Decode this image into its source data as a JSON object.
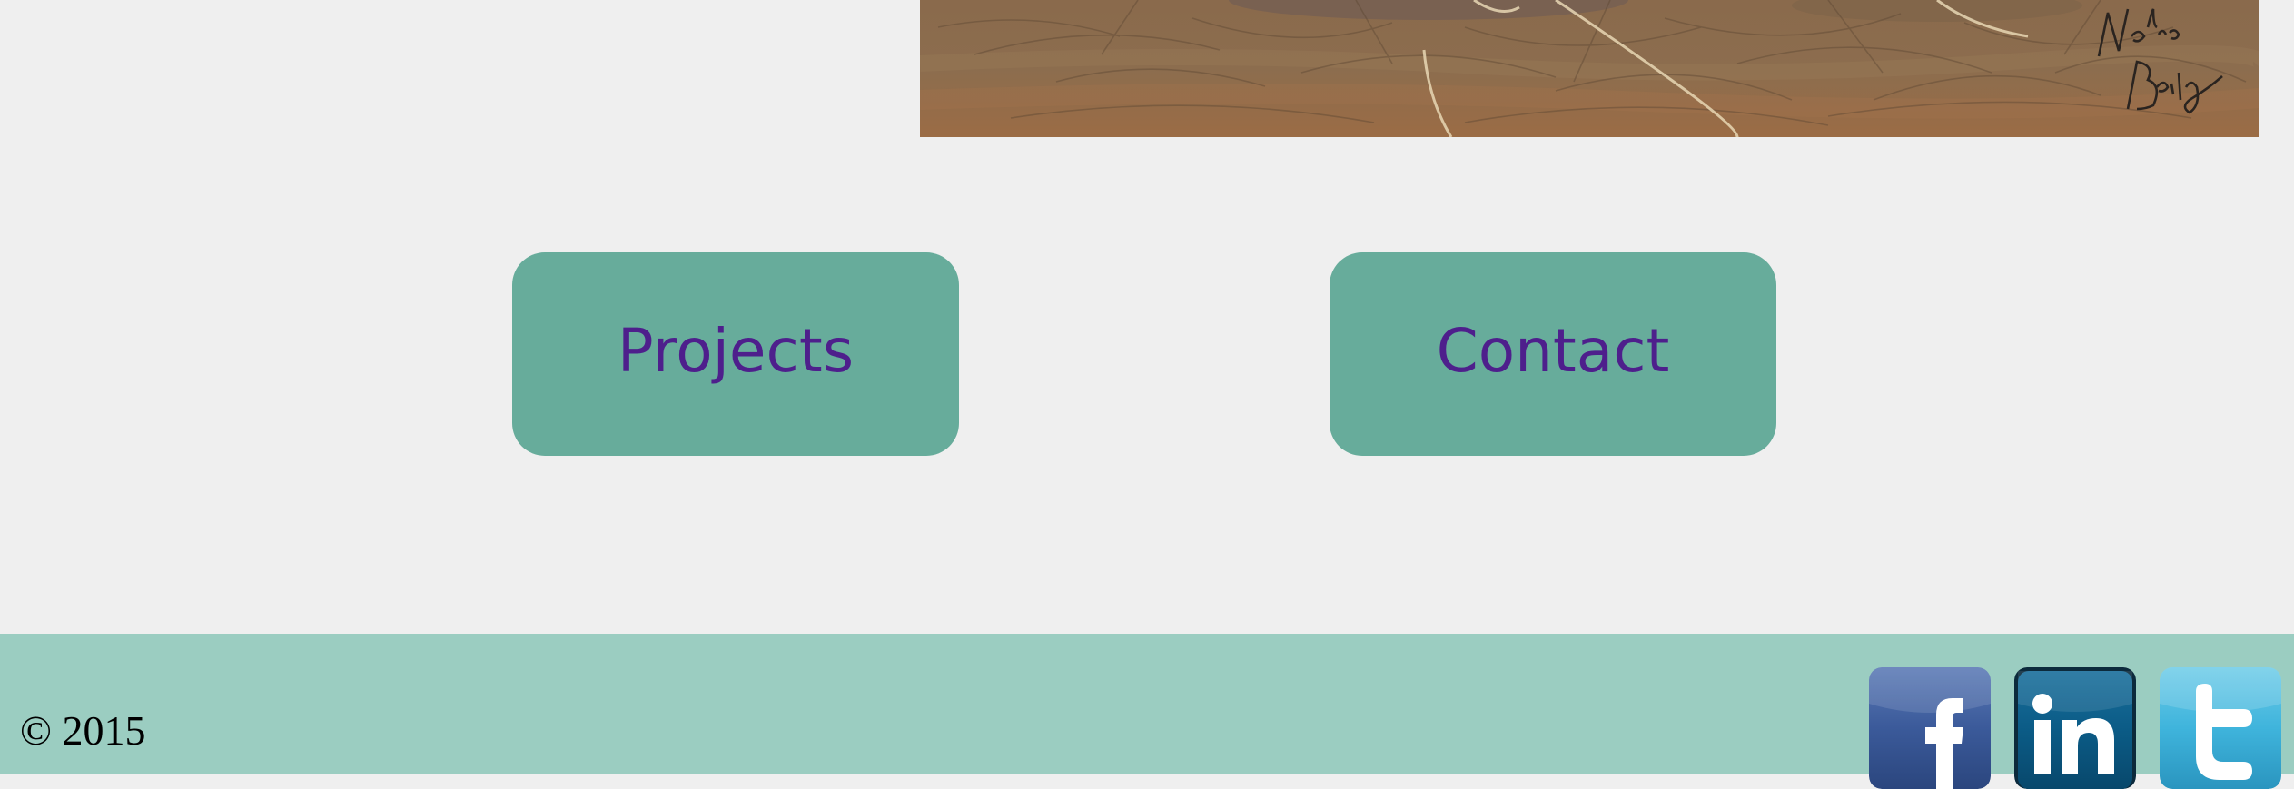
{
  "artwork": {
    "description_alt": "Painted artwork banner",
    "signature": "Nadine Bailey"
  },
  "nav": {
    "projects_label": "Projects",
    "contact_label": "Contact"
  },
  "footer": {
    "copyright": "© 2015",
    "social": [
      {
        "name": "facebook-icon",
        "letter": "f"
      },
      {
        "name": "linkedin-icon",
        "letter": "in"
      },
      {
        "name": "twitter-icon",
        "letter": "t"
      }
    ]
  },
  "colors": {
    "background": "#efefef",
    "button": "#67ac9b",
    "button_text": "#4e1f8c",
    "footer": "#9bcdc1",
    "facebook": "#3b5a9a",
    "linkedin": "#0b5b86",
    "twitter": "#3fb4dc"
  }
}
